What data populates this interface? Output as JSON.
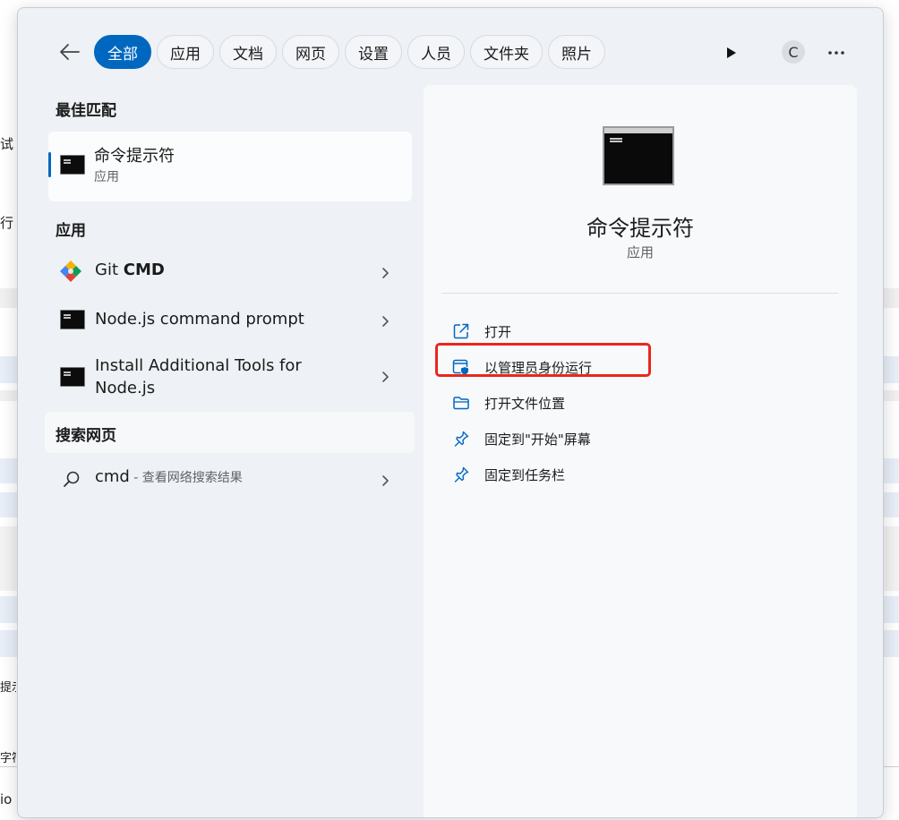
{
  "background": {
    "snippets": [
      "试",
      "行",
      "提示",
      "字符",
      "io"
    ]
  },
  "topbar": {
    "tabs": [
      "全部",
      "应用",
      "文档",
      "网页",
      "设置",
      "人员",
      "文件夹",
      "照片"
    ],
    "avatar_letter": "C"
  },
  "best_match": {
    "header": "最佳匹配",
    "title": "命令提示符",
    "subtitle": "应用"
  },
  "apps": {
    "header": "应用",
    "items": [
      {
        "name_prefix": "Git ",
        "name_bold": "CMD",
        "icon": "git-icon"
      },
      {
        "name": "Node.js command prompt",
        "icon": "console-icon"
      },
      {
        "name_line1": "Install Additional Tools for",
        "name_line2": "Node.js",
        "icon": "console-icon"
      }
    ]
  },
  "web_search": {
    "header": "搜索网页",
    "query": "cmd",
    "hint": " - 查看网络搜索结果"
  },
  "detail": {
    "title": "命令提示符",
    "kind": "应用",
    "actions": [
      {
        "label": "打开",
        "icon": "open-external-icon"
      },
      {
        "label": "以管理员身份运行",
        "icon": "admin-shield-icon"
      },
      {
        "label": "打开文件位置",
        "icon": "folder-icon"
      },
      {
        "label": "固定到\"开始\"屏幕",
        "icon": "pin-icon"
      },
      {
        "label": "固定到任务栏",
        "icon": "pin-icon"
      }
    ]
  },
  "colors": {
    "accent": "#0067c0",
    "highlight": "#e8271f"
  }
}
